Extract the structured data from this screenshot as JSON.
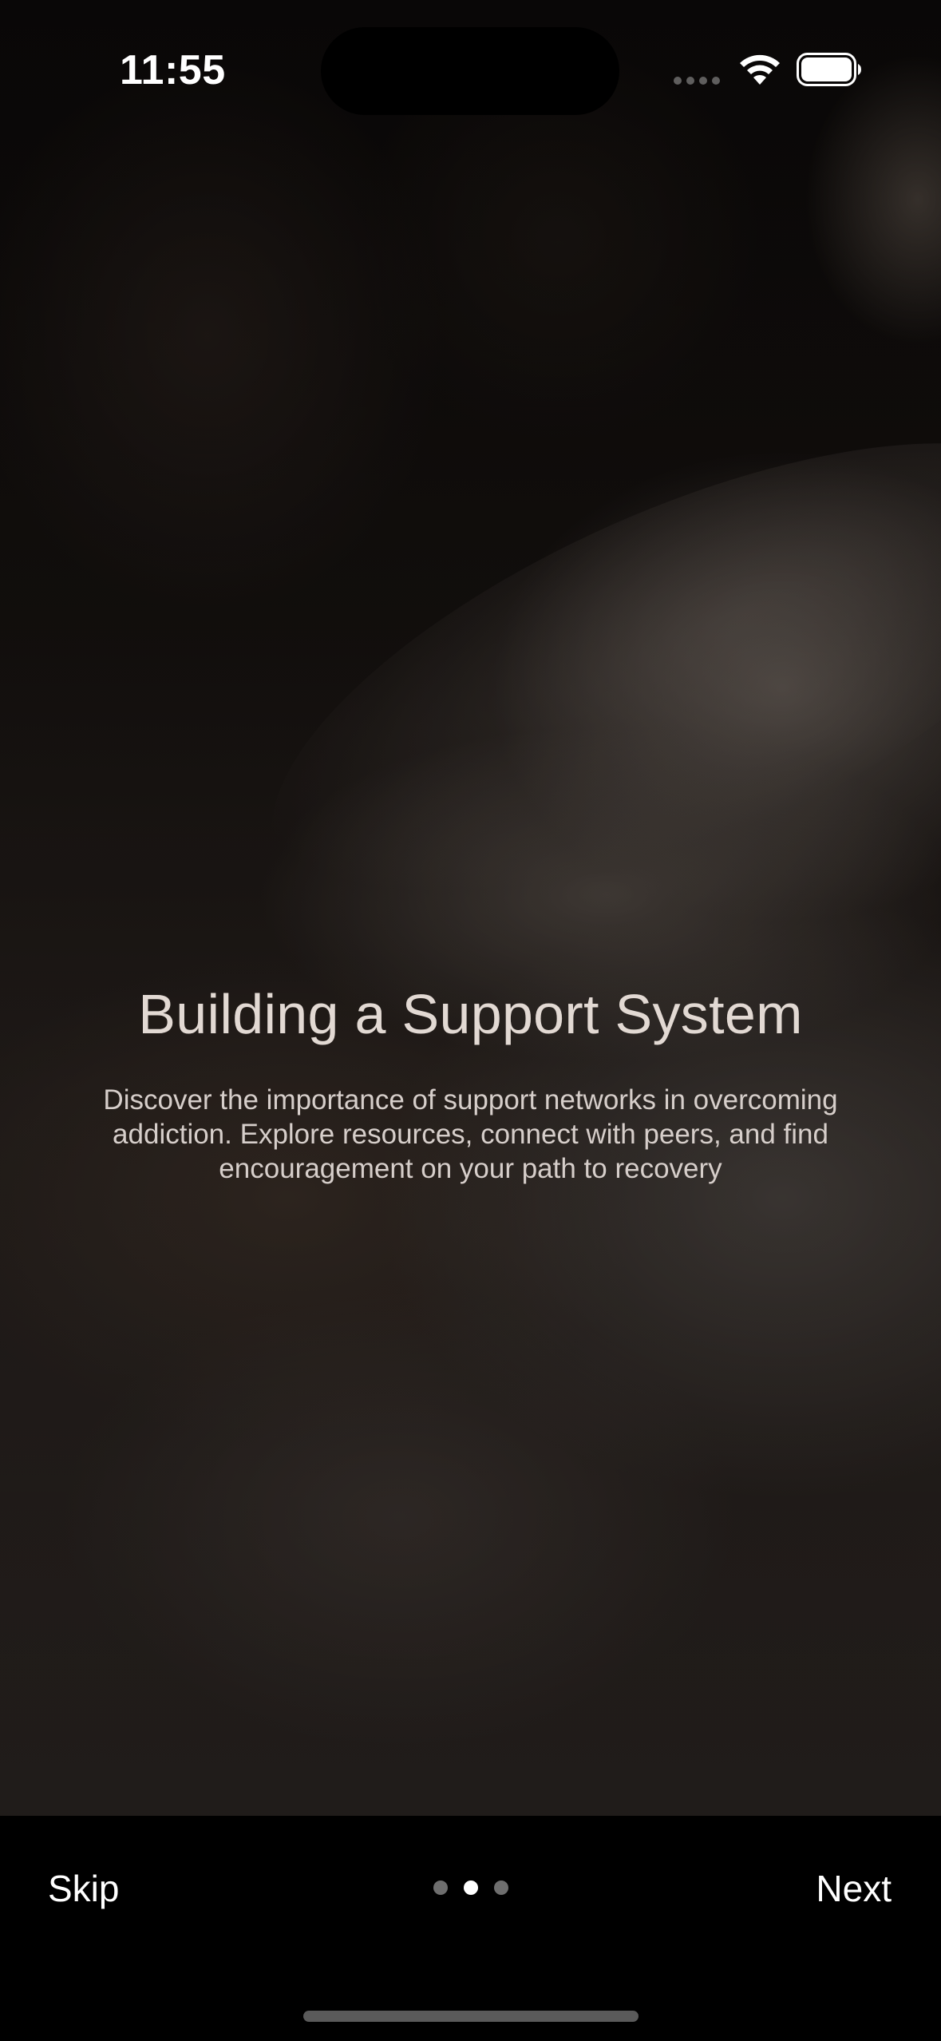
{
  "status_bar": {
    "time": "11:55",
    "icons": [
      "signal-icon",
      "wifi-icon",
      "battery-icon"
    ]
  },
  "onboarding": {
    "title": "Building a Support System",
    "description": "Discover the importance of support networks in overcoming addiction. Explore resources, connect with peers, and find encouragement on your path to recovery",
    "page_total": 3,
    "active_page": 2
  },
  "footer": {
    "skip_label": "Skip",
    "next_label": "Next"
  },
  "colors": {
    "title": "#e2d9d3",
    "description": "#d6ceca",
    "bottom_bar": "#000000",
    "dot_active": "#ffffff",
    "dot_inactive": "#6e6e6e"
  }
}
